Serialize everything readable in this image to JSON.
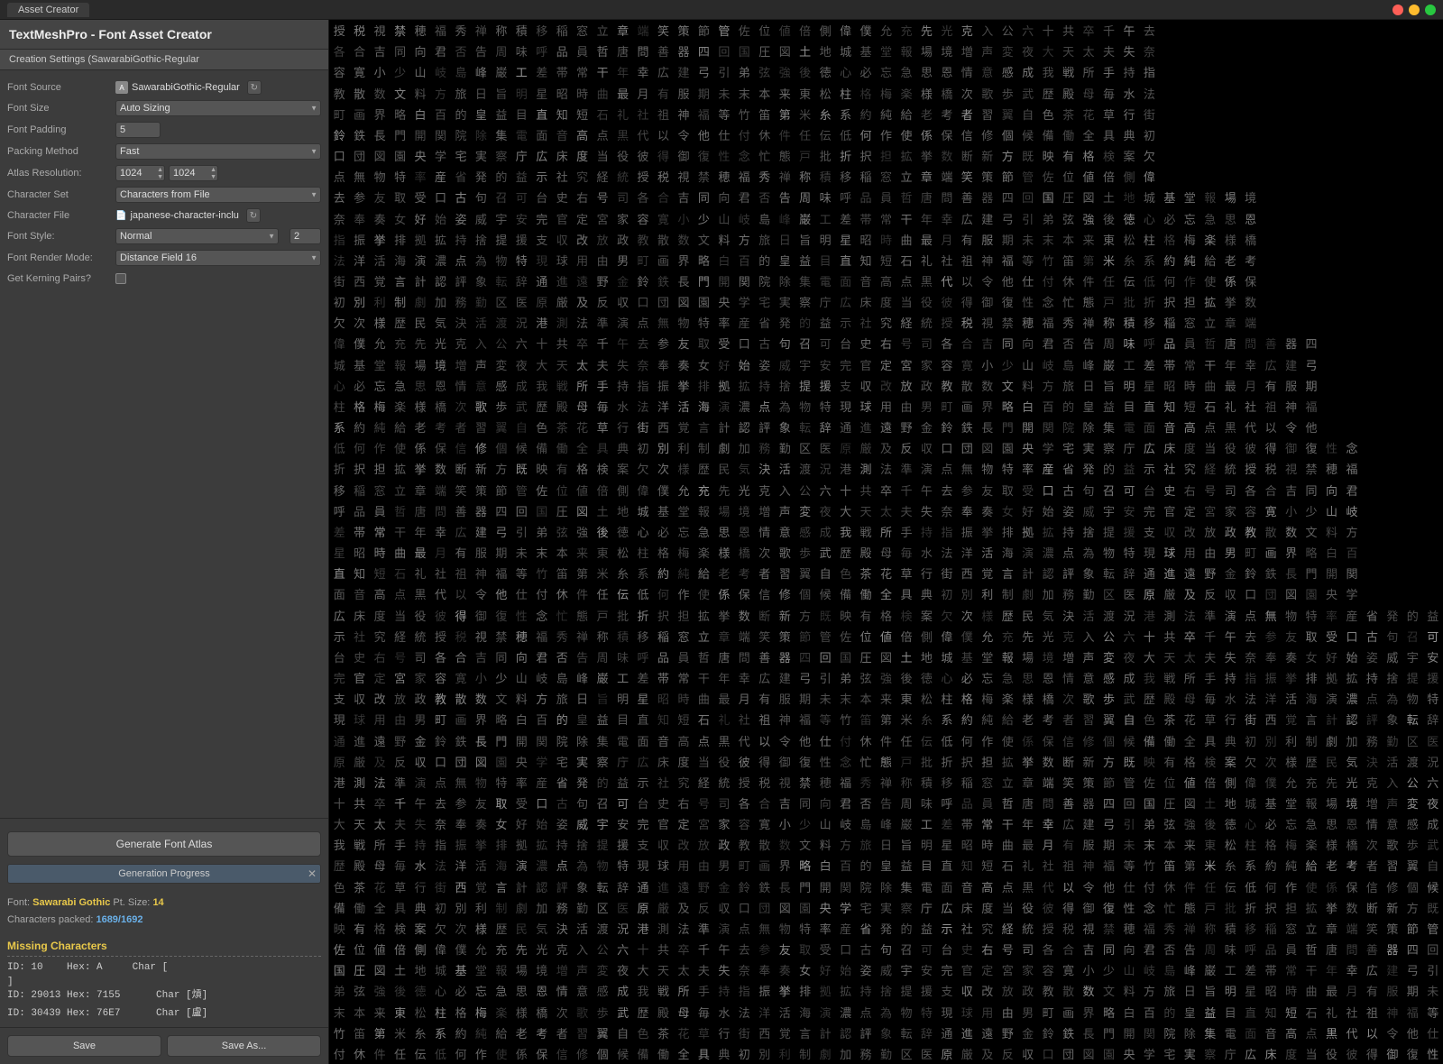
{
  "titleBar": {
    "tabLabel": "Asset Creator"
  },
  "leftPanel": {
    "title": "TextMeshPro - Font Asset Creator",
    "creationSettings": "Creation Settings (SawarabiGothic-Regular",
    "fields": {
      "fontSource": {
        "label": "Font Source",
        "value": "SawarabiGothic-Regular",
        "icon": "A"
      },
      "fontSize": {
        "label": "Font Size",
        "value": "Auto Sizing"
      },
      "fontPadding": {
        "label": "Font Padding",
        "value": "5"
      },
      "packingMethod": {
        "label": "Packing Method",
        "value": "Fast"
      },
      "atlasResolution": {
        "label": "Atlas Resolution:",
        "width": "1024",
        "height": "1024"
      },
      "characterSet": {
        "label": "Character Set",
        "value": "Characters from File"
      },
      "characterFile": {
        "label": "Character File",
        "icon": "📄",
        "value": "japanese-character-inclu"
      },
      "fontStyle": {
        "label": "Font Style:",
        "value": "Normal",
        "number": "2"
      },
      "fontRenderMode": {
        "label": "Font Render Mode:",
        "value": "Distance Field 16"
      },
      "getKerningPairs": {
        "label": "Get Kerning Pairs?"
      }
    },
    "generateBtn": "Generate Font Atlas",
    "progressBar": {
      "label": "Generation Progress",
      "closeBtn": "✕"
    },
    "generationInfo": {
      "fontLabel": "Font:",
      "fontName": "Sawarabi Gothic",
      "ptSizeLabel": "Pt. Size:",
      "ptSize": "14",
      "charPackedLabel": "Characters packed:",
      "charPacked": "1689/1692"
    },
    "missingChars": {
      "title": "Missing Characters",
      "entries": [
        {
          "id": "10",
          "hex": "A",
          "char": "[",
          "charEnd": "]"
        },
        {
          "id": "29013",
          "hex": "7155",
          "char": "熕"
        },
        {
          "id": "30439",
          "hex": "76E7",
          "char": "盧"
        }
      ]
    },
    "bottomBtns": {
      "save": "Save",
      "saveAs": "Save As..."
    }
  },
  "kanjiChars": [
    "授",
    "税",
    "視",
    "禁",
    "穂",
    "福",
    "秀",
    "禅",
    "称",
    "積",
    "移",
    "稲",
    "窓",
    "立",
    "章",
    "端",
    "笑",
    "策",
    "節",
    "管",
    "佐",
    "位",
    "値",
    "倍",
    "側",
    "偉",
    "僕",
    "允",
    "充",
    "先",
    "光",
    "克",
    "入",
    "公",
    "六",
    "十",
    "共",
    "卒",
    "千",
    "午",
    "去",
    "参",
    "友",
    "取",
    "受",
    "口",
    "古",
    "句",
    "召",
    "可",
    "台",
    "史",
    "右",
    "号",
    "司",
    "各",
    "合",
    "吉",
    "同",
    "向",
    "君",
    "否",
    "告",
    "周",
    "味",
    "呼",
    "品",
    "員",
    "哲",
    "唐",
    "問",
    "善",
    "器",
    "四",
    "回",
    "国",
    "圧",
    "図",
    "土",
    "地",
    "城",
    "基",
    "堂",
    "報",
    "場",
    "境",
    "増",
    "声",
    "変",
    "夜",
    "大",
    "天",
    "太",
    "夫",
    "失",
    "奈",
    "奉",
    "奏",
    "女",
    "好",
    "始",
    "姿",
    "威",
    "宇",
    "安",
    "完",
    "官",
    "定",
    "宮",
    "家",
    "容",
    "寛",
    "小",
    "少",
    "山",
    "岐",
    "島",
    "峰",
    "巌",
    "工",
    "差",
    "帯",
    "常",
    "干",
    "年",
    "幸",
    "広",
    "建",
    "弓",
    "引",
    "弟",
    "弦",
    "強",
    "後",
    "徳",
    "心",
    "必",
    "忘",
    "急",
    "思",
    "恩",
    "情",
    "意",
    "感",
    "成",
    "我",
    "戦",
    "所",
    "手",
    "持",
    "指",
    "振",
    "挙",
    "排",
    "拠",
    "拡",
    "持",
    "捨",
    "提",
    "援",
    "支",
    "収",
    "改",
    "放",
    "政",
    "教",
    "散",
    "数",
    "文",
    "料",
    "方",
    "旅",
    "日",
    "旨",
    "明",
    "星",
    "昭",
    "時",
    "曲",
    "最",
    "月",
    "有",
    "服",
    "期",
    "未",
    "末",
    "本",
    "来",
    "東",
    "松",
    "柱",
    "格",
    "梅",
    "楽",
    "様",
    "橋",
    "次",
    "歌",
    "歩",
    "武",
    "歴",
    "殿",
    "母",
    "毎",
    "水",
    "法",
    "洋",
    "活",
    "海",
    "演",
    "濃",
    "点",
    "為",
    "物",
    "特",
    "現",
    "球",
    "用",
    "由",
    "男",
    "町",
    "画",
    "界",
    "略",
    "白",
    "百",
    "的",
    "皇",
    "益",
    "目",
    "直",
    "知",
    "短",
    "石",
    "礼",
    "社",
    "祖",
    "神",
    "福",
    "等",
    "竹",
    "笛",
    "第",
    "米",
    "糸",
    "系",
    "約",
    "純",
    "給",
    "老",
    "考",
    "者",
    "習",
    "翼",
    "自",
    "色",
    "茶",
    "花",
    "草",
    "行",
    "街",
    "西",
    "覚",
    "言",
    "計",
    "認",
    "評",
    "象",
    "転",
    "辞",
    "通",
    "進",
    "遠",
    "野",
    "金",
    "鈴",
    "鉄",
    "長",
    "門",
    "開",
    "関",
    "院",
    "除",
    "集",
    "電",
    "面",
    "音",
    "高",
    "点",
    "黒",
    "代",
    "以",
    "令",
    "他",
    "仕",
    "付",
    "休",
    "件",
    "任",
    "伝",
    "低",
    "何",
    "作",
    "使",
    "係",
    "保",
    "信",
    "修",
    "個",
    "候",
    "備",
    "働",
    "全",
    "具",
    "典",
    "初",
    "別",
    "利",
    "制",
    "劇",
    "加",
    "務",
    "勤",
    "区",
    "医",
    "原",
    "厳",
    "及",
    "反",
    "収",
    "口",
    "団",
    "図",
    "園",
    "央",
    "学",
    "宅",
    "実",
    "察",
    "庁",
    "広",
    "床",
    "度",
    "当",
    "役",
    "彼",
    "得",
    "御",
    "復",
    "性",
    "念",
    "忙",
    "態",
    "戸",
    "批",
    "折",
    "択",
    "担",
    "拡",
    "挙",
    "数",
    "断",
    "新",
    "方",
    "既",
    "映",
    "有",
    "格",
    "検",
    "案",
    "欠",
    "次",
    "様",
    "歴",
    "民",
    "気",
    "決",
    "活",
    "渡",
    "況",
    "港",
    "測",
    "法",
    "準",
    "演",
    "点",
    "無",
    "物",
    "特",
    "率",
    "産",
    "省",
    "発",
    "的",
    "益",
    "示",
    "社",
    "究",
    "経",
    "統"
  ]
}
